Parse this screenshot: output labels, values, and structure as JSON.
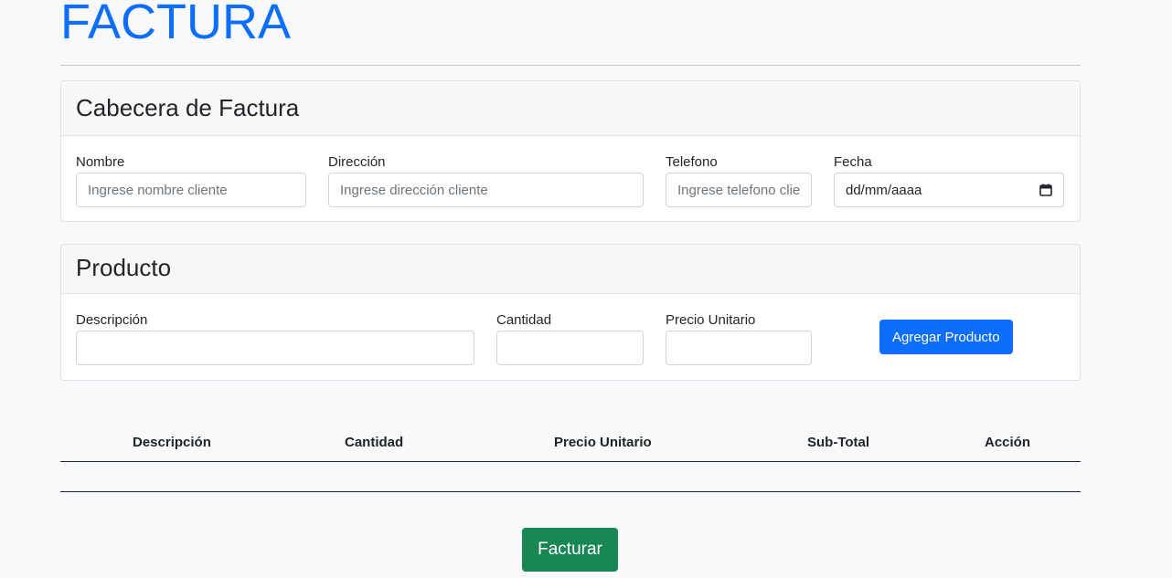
{
  "page": {
    "title": "FACTURA"
  },
  "header_card": {
    "title": "Cabecera de Factura",
    "fields": {
      "nombre": {
        "label": "Nombre",
        "placeholder": "Ingrese nombre cliente"
      },
      "direccion": {
        "label": "Dirección",
        "placeholder": "Ingrese dirección cliente"
      },
      "telefono": {
        "label": "Telefono",
        "placeholder": "Ingrese telefono cliente"
      },
      "fecha": {
        "label": "Fecha",
        "value": "dd/mm/aaaa",
        "icon": "calendar-icon"
      }
    }
  },
  "product_card": {
    "title": "Producto",
    "fields": {
      "descripcion": {
        "label": "Descripción"
      },
      "cantidad": {
        "label": "Cantidad"
      },
      "precio": {
        "label": "Precio Unitario"
      }
    },
    "add_button": "Agregar Producto"
  },
  "table": {
    "headers": [
      "Descripción",
      "Cantidad",
      "Precio Unitario",
      "Sub-Total",
      "Acción"
    ]
  },
  "submit_button": "Facturar",
  "colors": {
    "primary": "#0d6efd",
    "success": "#198754"
  }
}
